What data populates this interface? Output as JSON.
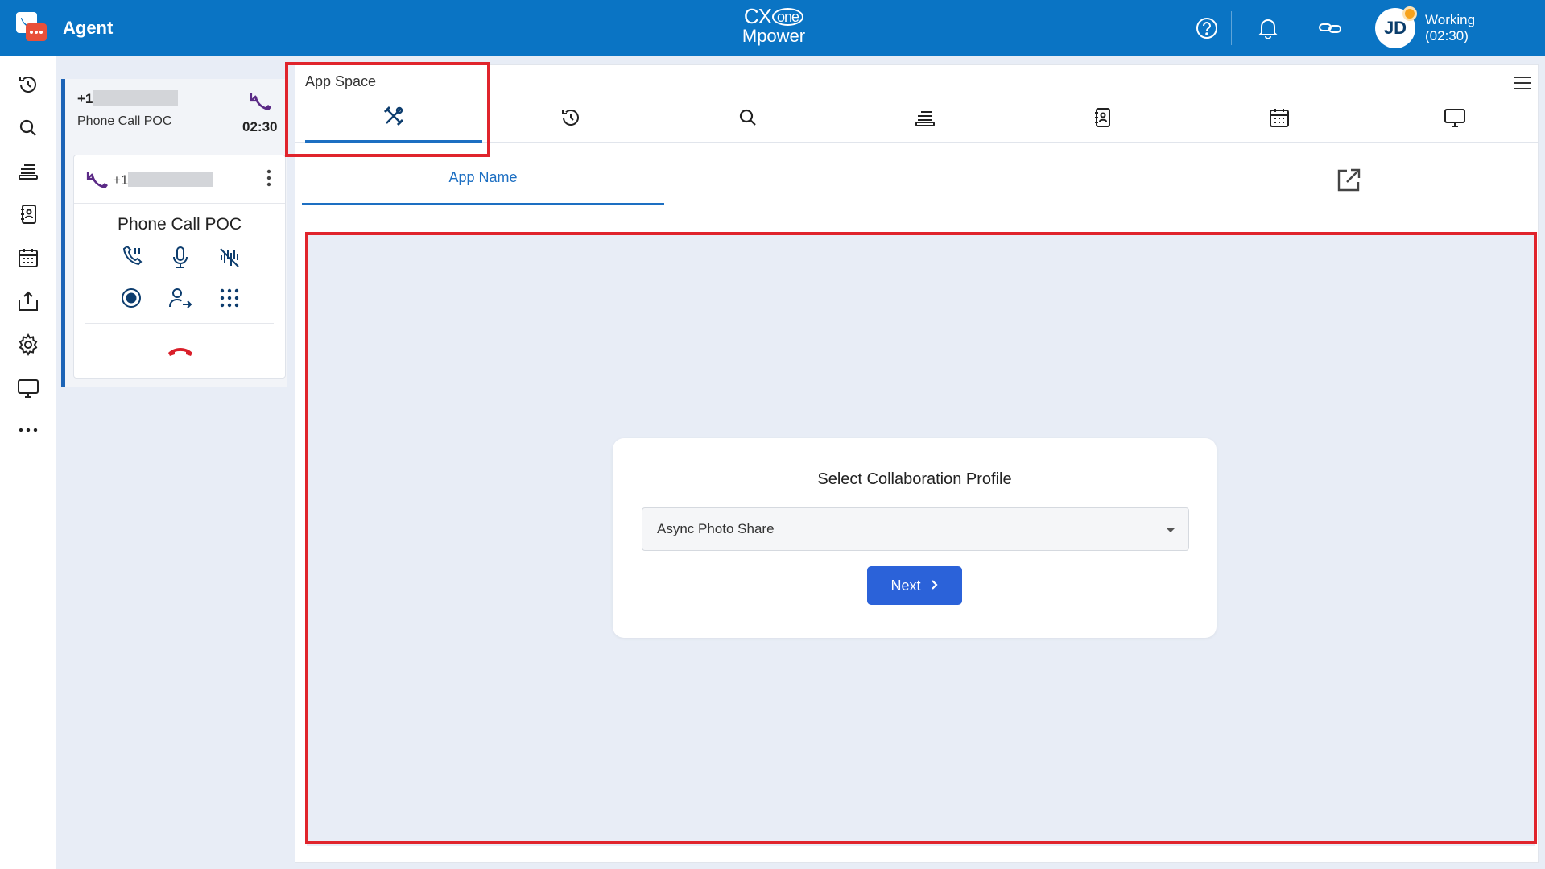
{
  "topbar": {
    "app_title": "Agent",
    "brand_line1": "CX",
    "brand_one": "one",
    "brand_line2": "Mpower",
    "avatar_initials": "JD",
    "status_label": "Working",
    "status_timer": "(02:30)",
    "icons": [
      "help-icon",
      "bell-icon",
      "link-icon"
    ]
  },
  "leftnav": {
    "icons": [
      "history-icon",
      "search-icon",
      "queue-icon",
      "contacts-book-icon",
      "calendar-icon",
      "upload-icon",
      "settings-icon",
      "monitor-icon",
      "more-icon"
    ]
  },
  "contact": {
    "number_prefix": "+1",
    "label": "Phone Call POC",
    "timer": "02:30",
    "panel_number_prefix": "+1",
    "panel_title": "Phone Call POC"
  },
  "appspace": {
    "title": "App Space",
    "tabs": [
      "tools-icon",
      "history-icon",
      "search-icon",
      "queue-icon",
      "contacts-book-icon",
      "calendar-icon",
      "monitor-icon"
    ],
    "subtab_label": "App Name",
    "collab": {
      "title": "Select Collaboration Profile",
      "selected_profile": "Async Photo Share",
      "next_label": "Next"
    }
  },
  "colors": {
    "topbar": "#0a74c4",
    "accent": "#1d6fc2",
    "button": "#2b62d9",
    "highlight": "#e0242c",
    "hangup": "#d91f2a",
    "incoming": "#5b2a86"
  }
}
